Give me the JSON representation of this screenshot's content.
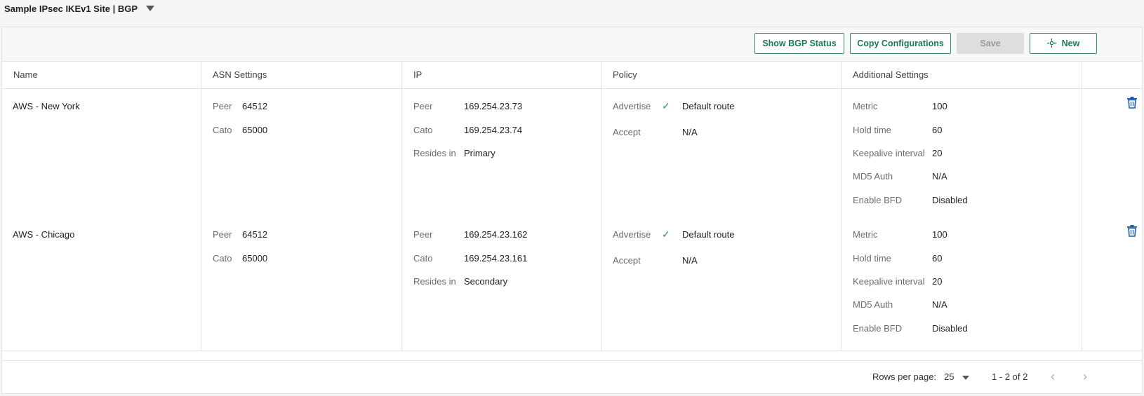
{
  "header": {
    "title": "Sample IPsec IKEv1 Site | BGP"
  },
  "toolbar": {
    "show_bgp_status": "Show BGP Status",
    "copy_configurations": "Copy Configurations",
    "save": "Save",
    "new": "New"
  },
  "columns": [
    "Name",
    "ASN Settings",
    "IP",
    "Policy",
    "Additional Settings"
  ],
  "labels": {
    "peer": "Peer",
    "cato": "Cato",
    "resides_in": "Resides in",
    "advertise": "Advertise",
    "accept": "Accept",
    "metric": "Metric",
    "hold_time": "Hold time",
    "keepalive": "Keepalive interval",
    "md5": "MD5 Auth",
    "bfd": "Enable BFD"
  },
  "rows": [
    {
      "name": "AWS - New York",
      "asn_peer": "64512",
      "asn_cato": "65000",
      "ip_peer": "169.254.23.73",
      "ip_cato": "169.254.23.74",
      "resides_in": "Primary",
      "advertise": "Default route",
      "accept": "N/A",
      "metric": "100",
      "hold_time": "60",
      "keepalive": "20",
      "md5": "N/A",
      "bfd": "Disabled"
    },
    {
      "name": "AWS - Chicago",
      "asn_peer": "64512",
      "asn_cato": "65000",
      "ip_peer": "169.254.23.162",
      "ip_cato": "169.254.23.161",
      "resides_in": "Secondary",
      "advertise": "Default route",
      "accept": "N/A",
      "metric": "100",
      "hold_time": "60",
      "keepalive": "20",
      "md5": "N/A",
      "bfd": "Disabled"
    }
  ],
  "footer": {
    "rows_per_page_label": "Rows per page:",
    "rows_per_page": "25",
    "range": "1 - 2 of 2"
  },
  "colors": {
    "accent": "#2f8f62",
    "trash": "#1f5fae"
  }
}
